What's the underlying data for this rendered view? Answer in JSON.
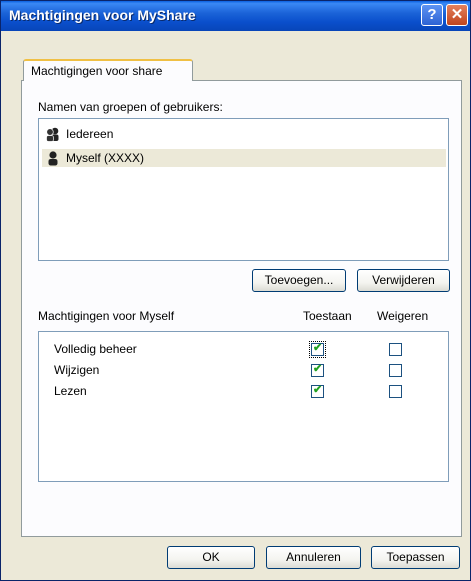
{
  "window": {
    "title": "Machtigingen voor MyShare"
  },
  "tab": {
    "label": "Machtigingen voor share"
  },
  "groups": {
    "label": "Namen van groepen of gebruikers:",
    "items": [
      {
        "name": "Iedereen",
        "icon": "group-icon",
        "selected": false
      },
      {
        "name": "Myself (XXXX)",
        "icon": "user-icon",
        "selected": true
      }
    ],
    "add_label": "Toevoegen...",
    "remove_label": "Verwijderen"
  },
  "permissions": {
    "header": "Machtigingen voor Myself",
    "allow_header": "Toestaan",
    "deny_header": "Weigeren",
    "rows": [
      {
        "name": "Volledig beheer",
        "allow": true,
        "deny": false
      },
      {
        "name": "Wijzigen",
        "allow": true,
        "deny": false
      },
      {
        "name": "Lezen",
        "allow": true,
        "deny": false
      }
    ]
  },
  "footer": {
    "ok_label": "OK",
    "cancel_label": "Annuleren",
    "apply_label": "Toepassen"
  },
  "colors": {
    "title_bar": "#0a4fcc",
    "checkmark": "#21a121",
    "selection": "#ece9d8"
  }
}
